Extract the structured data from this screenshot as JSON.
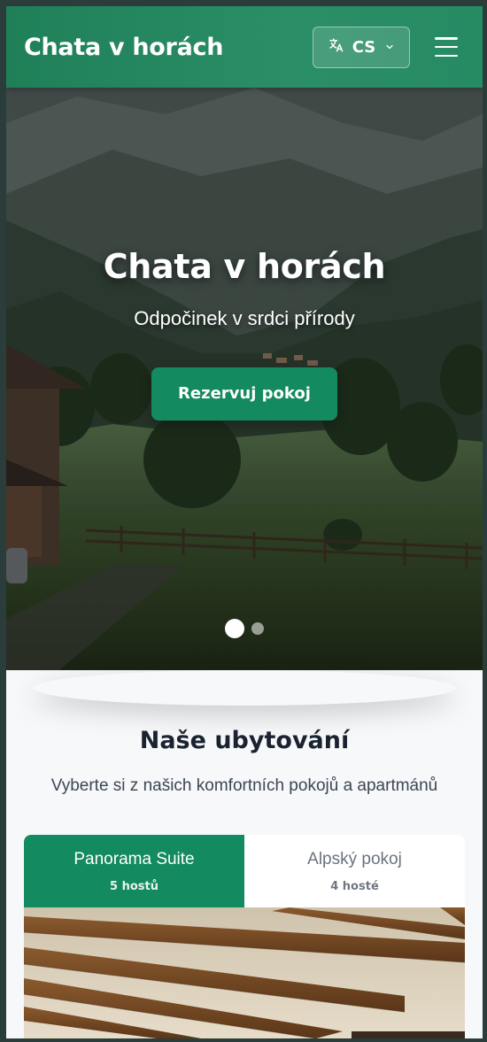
{
  "header": {
    "brand": "Chata v horách",
    "language": {
      "code": "CS",
      "icon": "translate-icon",
      "chevron": "chevron-down-icon"
    },
    "menu_icon": "hamburger-menu-icon"
  },
  "hero": {
    "title": "Chata v horách",
    "subtitle": "Odpočinek v srdci přírody",
    "cta_label": "Rezervuj pokoj",
    "slides_count": 2,
    "active_slide": 1
  },
  "accommodation": {
    "title": "Naše ubytování",
    "subtitle": "Vyberte si z našich komfortních pokojů a apartmánů",
    "tabs": [
      {
        "name": "Panorama Suite",
        "guests": "5 hostů",
        "active": true
      },
      {
        "name": "Alpský pokoj",
        "guests": "4 hosté",
        "active": false
      }
    ]
  },
  "colors": {
    "primary_green": "#138a5f",
    "header_green": "#268a63",
    "dark_text": "#1b2330"
  }
}
